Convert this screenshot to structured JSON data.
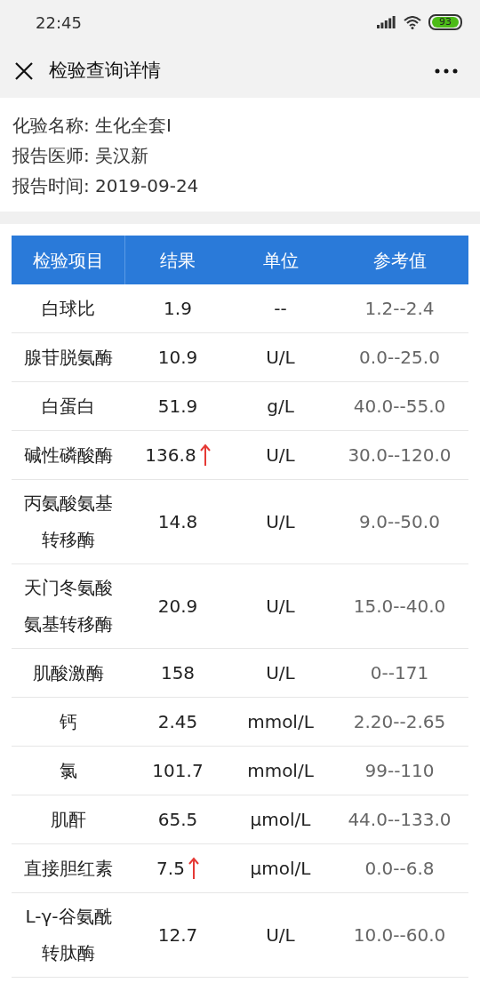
{
  "status_bar": {
    "time": "22:45",
    "battery": "93"
  },
  "header": {
    "title": "检验查询详情"
  },
  "info": [
    {
      "label": "化验名称:",
      "value": "生化全套I"
    },
    {
      "label": "报告医师:",
      "value": "吴汉新"
    },
    {
      "label": "报告时间:",
      "value": "2019-09-24"
    }
  ],
  "table": {
    "columns": [
      "检验项目",
      "结果",
      "单位",
      "参考值"
    ],
    "rows": [
      {
        "item": "白球比",
        "result": "1.9",
        "unit": "--",
        "reference": "1.2--2.4",
        "high": false
      },
      {
        "item": "腺苷脱氨酶",
        "result": "10.9",
        "unit": "U/L",
        "reference": "0.0--25.0",
        "high": false
      },
      {
        "item": "白蛋白",
        "result": "51.9",
        "unit": "g/L",
        "reference": "40.0--55.0",
        "high": false
      },
      {
        "item": "碱性磷酸酶",
        "result": "136.8",
        "unit": "U/L",
        "reference": "30.0--120.0",
        "high": true
      },
      {
        "item": "丙氨酸氨基转移酶",
        "result": "14.8",
        "unit": "U/L",
        "reference": "9.0--50.0",
        "high": false
      },
      {
        "item": "天门冬氨酸氨基转移酶",
        "result": "20.9",
        "unit": "U/L",
        "reference": "15.0--40.0",
        "high": false
      },
      {
        "item": "肌酸激酶",
        "result": "158",
        "unit": "U/L",
        "reference": "0--171",
        "high": false
      },
      {
        "item": "钙",
        "result": "2.45",
        "unit": "mmol/L",
        "reference": "2.20--2.65",
        "high": false
      },
      {
        "item": "氯",
        "result": "101.7",
        "unit": "mmol/L",
        "reference": "99--110",
        "high": false
      },
      {
        "item": "肌酐",
        "result": "65.5",
        "unit": "μmol/L",
        "reference": "44.0--133.0",
        "high": false
      },
      {
        "item": "直接胆红素",
        "result": "7.5",
        "unit": "μmol/L",
        "reference": "0.0--6.8",
        "high": true
      },
      {
        "item": "L-γ-谷氨酰转肽酶",
        "result": "12.7",
        "unit": "U/L",
        "reference": "10.0--60.0",
        "high": false
      }
    ]
  }
}
